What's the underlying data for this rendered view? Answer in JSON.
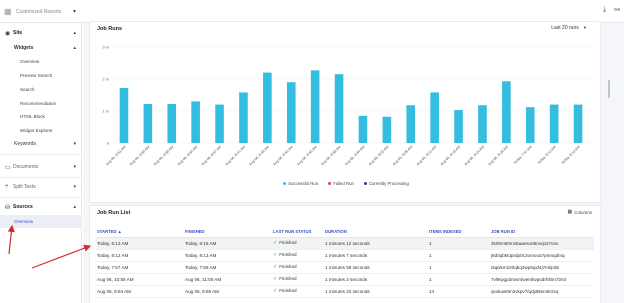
{
  "topbar": {
    "breadcrumb": "Customized Reports",
    "download_icon": "download-icon",
    "link_icon": "link-icon"
  },
  "sidebar": {
    "site_label": "Site",
    "widgets_label": "Widgets",
    "widget_items": [
      "Overview",
      "Preview Search",
      "Search",
      "Recommendation",
      "HTML Block",
      "Widget Explorer"
    ],
    "keywords_label": "Keywords",
    "documents_label": "Documents",
    "split_tests_label": "Split Tests",
    "sources_label": "Sources",
    "sources_items": [
      "Overview"
    ]
  },
  "chart_card": {
    "title": "Job Runs",
    "range_select": "Last 20 runs",
    "legend": [
      {
        "label": "Successful Run",
        "color": "#35bde0"
      },
      {
        "label": "Failed Run",
        "color": "#e33f5d"
      },
      {
        "label": "Currently Processing",
        "color": "#2e3b8c"
      }
    ]
  },
  "chart_data": {
    "type": "bar",
    "title": "Job Runs",
    "ylim": [
      0,
      3
    ],
    "yticks": [
      "3 m",
      "2 m",
      "1 m",
      "0"
    ],
    "categories": [
      "Aug 06, 8:52 AM",
      "Aug 06, 8:55 AM",
      "Aug 06, 8:58 AM",
      "Aug 06, 8:56 AM",
      "Aug 06, 8:57 AM",
      "Aug 06, 8:41 AM",
      "Aug 06, 8:48 AM",
      "Aug 06, 8:52 AM",
      "Aug 06, 8:55 AM",
      "Aug 06, 8:58 AM",
      "Aug 06, 8:54 AM",
      "Aug 06, 9:02 AM",
      "Aug 06, 9:08 AM",
      "Aug 06, 9:12 AM",
      "Aug 06, 9:18 AM",
      "Aug 06, 9:24 AM",
      "Aug 06, 9:28 AM",
      "Today, 7:57 AM",
      "Today, 8:12 AM",
      "Today, 8:13 AM"
    ],
    "series": [
      {
        "name": "Successful Run",
        "color": "#35bde0",
        "values": [
          1.72,
          1.22,
          1.22,
          1.3,
          1.2,
          1.58,
          2.2,
          1.9,
          2.27,
          2.15,
          0.85,
          0.82,
          1.18,
          1.58,
          1.03,
          1.18,
          1.93,
          1.12,
          1.2,
          1.2
        ]
      }
    ]
  },
  "table_card": {
    "title": "Job Run List",
    "columns_button": "Columns",
    "headers": [
      "STARTED",
      "FINISHED",
      "LAST RUN STATUS",
      "DURATION",
      "ITEMS INDEXED",
      "JOB RUN ID"
    ],
    "rows": [
      [
        "Today, 8:13 AM",
        "Today, 8:15 AM",
        "Finished",
        "1 minutes 12 seconds",
        "1",
        "3s00m80ms6aaesu06mvip27onx"
      ],
      [
        "Today, 8:12 AM",
        "Today, 8:13 AM",
        "Finished",
        "1 minutes 7 seconds",
        "1",
        "j8d0qbMJprdp0c2omooa7pmnqdmq"
      ],
      [
        "Today, 7:57 AM",
        "Today, 7:59 AM",
        "Finished",
        "1 minutes 58 seconds",
        "1",
        "i3qwkm220qbq3wp6qxf4j7mkp36"
      ],
      [
        "Aug 06, 10:59 AM",
        "Aug 06, 11:00 AM",
        "Finished",
        "1 minutes 2 seconds",
        "1",
        "7vl9rpgp2mwr4wemfwpodrhl0m72e3"
      ],
      [
        "Aug 06, 8:54 AM",
        "Aug 06, 8:55 AM",
        "Finished",
        "1 minutes 23 seconds",
        "14",
        "qvvkuw0m2vkpv7/qdy9ksm9r2xq"
      ]
    ]
  }
}
